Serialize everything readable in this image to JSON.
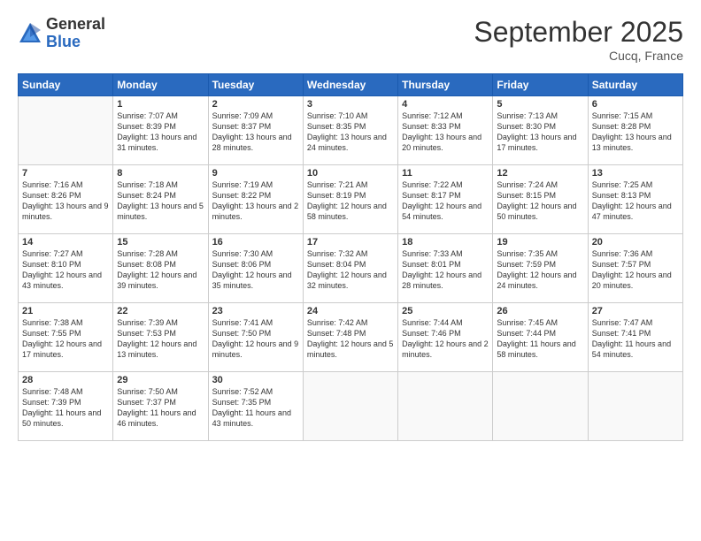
{
  "logo": {
    "general": "General",
    "blue": "Blue"
  },
  "header": {
    "month": "September 2025",
    "location": "Cucq, France"
  },
  "weekdays": [
    "Sunday",
    "Monday",
    "Tuesday",
    "Wednesday",
    "Thursday",
    "Friday",
    "Saturday"
  ],
  "weeks": [
    [
      {
        "day": "",
        "sunrise": "",
        "sunset": "",
        "daylight": ""
      },
      {
        "day": "1",
        "sunrise": "Sunrise: 7:07 AM",
        "sunset": "Sunset: 8:39 PM",
        "daylight": "Daylight: 13 hours and 31 minutes."
      },
      {
        "day": "2",
        "sunrise": "Sunrise: 7:09 AM",
        "sunset": "Sunset: 8:37 PM",
        "daylight": "Daylight: 13 hours and 28 minutes."
      },
      {
        "day": "3",
        "sunrise": "Sunrise: 7:10 AM",
        "sunset": "Sunset: 8:35 PM",
        "daylight": "Daylight: 13 hours and 24 minutes."
      },
      {
        "day": "4",
        "sunrise": "Sunrise: 7:12 AM",
        "sunset": "Sunset: 8:33 PM",
        "daylight": "Daylight: 13 hours and 20 minutes."
      },
      {
        "day": "5",
        "sunrise": "Sunrise: 7:13 AM",
        "sunset": "Sunset: 8:30 PM",
        "daylight": "Daylight: 13 hours and 17 minutes."
      },
      {
        "day": "6",
        "sunrise": "Sunrise: 7:15 AM",
        "sunset": "Sunset: 8:28 PM",
        "daylight": "Daylight: 13 hours and 13 minutes."
      }
    ],
    [
      {
        "day": "7",
        "sunrise": "Sunrise: 7:16 AM",
        "sunset": "Sunset: 8:26 PM",
        "daylight": "Daylight: 13 hours and 9 minutes."
      },
      {
        "day": "8",
        "sunrise": "Sunrise: 7:18 AM",
        "sunset": "Sunset: 8:24 PM",
        "daylight": "Daylight: 13 hours and 5 minutes."
      },
      {
        "day": "9",
        "sunrise": "Sunrise: 7:19 AM",
        "sunset": "Sunset: 8:22 PM",
        "daylight": "Daylight: 13 hours and 2 minutes."
      },
      {
        "day": "10",
        "sunrise": "Sunrise: 7:21 AM",
        "sunset": "Sunset: 8:19 PM",
        "daylight": "Daylight: 12 hours and 58 minutes."
      },
      {
        "day": "11",
        "sunrise": "Sunrise: 7:22 AM",
        "sunset": "Sunset: 8:17 PM",
        "daylight": "Daylight: 12 hours and 54 minutes."
      },
      {
        "day": "12",
        "sunrise": "Sunrise: 7:24 AM",
        "sunset": "Sunset: 8:15 PM",
        "daylight": "Daylight: 12 hours and 50 minutes."
      },
      {
        "day": "13",
        "sunrise": "Sunrise: 7:25 AM",
        "sunset": "Sunset: 8:13 PM",
        "daylight": "Daylight: 12 hours and 47 minutes."
      }
    ],
    [
      {
        "day": "14",
        "sunrise": "Sunrise: 7:27 AM",
        "sunset": "Sunset: 8:10 PM",
        "daylight": "Daylight: 12 hours and 43 minutes."
      },
      {
        "day": "15",
        "sunrise": "Sunrise: 7:28 AM",
        "sunset": "Sunset: 8:08 PM",
        "daylight": "Daylight: 12 hours and 39 minutes."
      },
      {
        "day": "16",
        "sunrise": "Sunrise: 7:30 AM",
        "sunset": "Sunset: 8:06 PM",
        "daylight": "Daylight: 12 hours and 35 minutes."
      },
      {
        "day": "17",
        "sunrise": "Sunrise: 7:32 AM",
        "sunset": "Sunset: 8:04 PM",
        "daylight": "Daylight: 12 hours and 32 minutes."
      },
      {
        "day": "18",
        "sunrise": "Sunrise: 7:33 AM",
        "sunset": "Sunset: 8:01 PM",
        "daylight": "Daylight: 12 hours and 28 minutes."
      },
      {
        "day": "19",
        "sunrise": "Sunrise: 7:35 AM",
        "sunset": "Sunset: 7:59 PM",
        "daylight": "Daylight: 12 hours and 24 minutes."
      },
      {
        "day": "20",
        "sunrise": "Sunrise: 7:36 AM",
        "sunset": "Sunset: 7:57 PM",
        "daylight": "Daylight: 12 hours and 20 minutes."
      }
    ],
    [
      {
        "day": "21",
        "sunrise": "Sunrise: 7:38 AM",
        "sunset": "Sunset: 7:55 PM",
        "daylight": "Daylight: 12 hours and 17 minutes."
      },
      {
        "day": "22",
        "sunrise": "Sunrise: 7:39 AM",
        "sunset": "Sunset: 7:53 PM",
        "daylight": "Daylight: 12 hours and 13 minutes."
      },
      {
        "day": "23",
        "sunrise": "Sunrise: 7:41 AM",
        "sunset": "Sunset: 7:50 PM",
        "daylight": "Daylight: 12 hours and 9 minutes."
      },
      {
        "day": "24",
        "sunrise": "Sunrise: 7:42 AM",
        "sunset": "Sunset: 7:48 PM",
        "daylight": "Daylight: 12 hours and 5 minutes."
      },
      {
        "day": "25",
        "sunrise": "Sunrise: 7:44 AM",
        "sunset": "Sunset: 7:46 PM",
        "daylight": "Daylight: 12 hours and 2 minutes."
      },
      {
        "day": "26",
        "sunrise": "Sunrise: 7:45 AM",
        "sunset": "Sunset: 7:44 PM",
        "daylight": "Daylight: 11 hours and 58 minutes."
      },
      {
        "day": "27",
        "sunrise": "Sunrise: 7:47 AM",
        "sunset": "Sunset: 7:41 PM",
        "daylight": "Daylight: 11 hours and 54 minutes."
      }
    ],
    [
      {
        "day": "28",
        "sunrise": "Sunrise: 7:48 AM",
        "sunset": "Sunset: 7:39 PM",
        "daylight": "Daylight: 11 hours and 50 minutes."
      },
      {
        "day": "29",
        "sunrise": "Sunrise: 7:50 AM",
        "sunset": "Sunset: 7:37 PM",
        "daylight": "Daylight: 11 hours and 46 minutes."
      },
      {
        "day": "30",
        "sunrise": "Sunrise: 7:52 AM",
        "sunset": "Sunset: 7:35 PM",
        "daylight": "Daylight: 11 hours and 43 minutes."
      },
      {
        "day": "",
        "sunrise": "",
        "sunset": "",
        "daylight": ""
      },
      {
        "day": "",
        "sunrise": "",
        "sunset": "",
        "daylight": ""
      },
      {
        "day": "",
        "sunrise": "",
        "sunset": "",
        "daylight": ""
      },
      {
        "day": "",
        "sunrise": "",
        "sunset": "",
        "daylight": ""
      }
    ]
  ]
}
